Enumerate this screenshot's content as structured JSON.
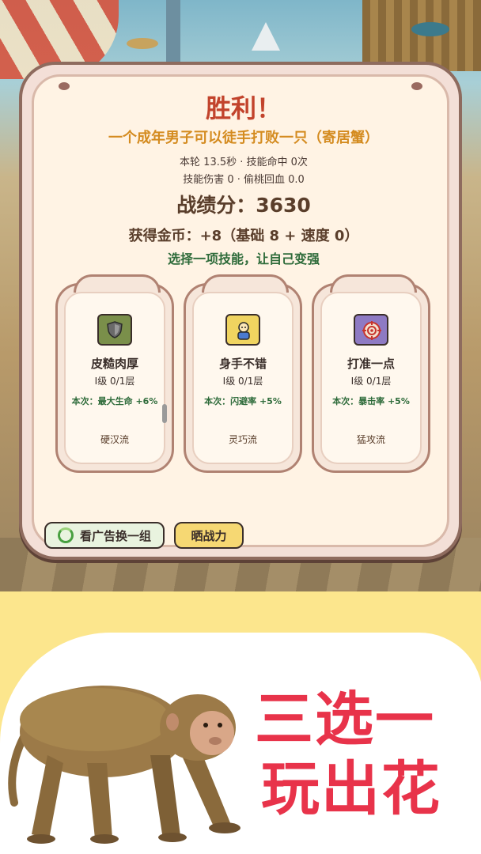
{
  "result": {
    "title": "胜利！",
    "subtitle": "一个成年男子可以徒手打败一只（寄居蟹）",
    "stats_line1": "本轮 13.5秒 · 技能命中 0次",
    "stats_line2": "技能伤害 0 · 偷桃回血 0.0",
    "score": "战绩分：3630",
    "coins": "获得金币：+8（基础 8 + 速度 0）",
    "prompt": "选择一项技能，让自己变强"
  },
  "skills": [
    {
      "name": "皮糙肉厚",
      "level": "I级 0/1层",
      "effect": "本次：最大生命 +6%",
      "style": "硬汉流",
      "icon": "shield-icon"
    },
    {
      "name": "身手不错",
      "level": "I级 0/1层",
      "effect": "本次：闪避率 +5%",
      "style": "灵巧流",
      "icon": "agile-person-icon"
    },
    {
      "name": "打准一点",
      "level": "I级 0/1层",
      "effect": "本次：暴击率 +5%",
      "style": "猛攻流",
      "icon": "target-icon"
    }
  ],
  "buttons": {
    "reroll_ad": "看广告换一组",
    "share": "晒战力"
  },
  "promo": {
    "line1": "三选一",
    "line2": "玩出花"
  },
  "colors": {
    "title": "#c2432c",
    "subtitle": "#d48b1f",
    "prompt": "#2e6b3a",
    "slogan": "#e8334a",
    "background": "#fce68d"
  }
}
